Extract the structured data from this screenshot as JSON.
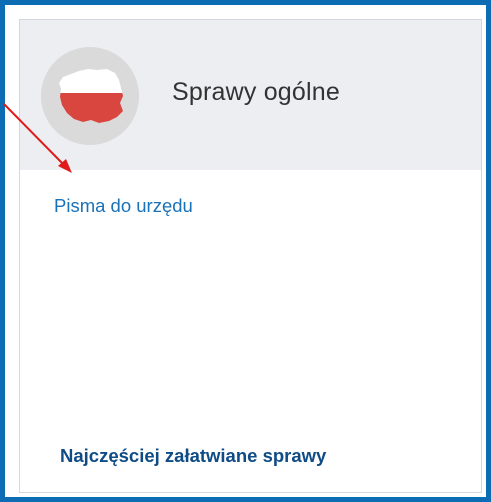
{
  "tile": {
    "title": "Sprawy ogólne",
    "icon": "poland-map-icon",
    "link_label": "Pisma do urzędu",
    "footer_label": "Najczęściej załatwiane sprawy"
  },
  "colors": {
    "frame_border": "#0c6db4",
    "header_background": "#eceef1",
    "link": "#1a72b8",
    "footer_link": "#0f4c86",
    "flag_red": "#d9463f",
    "annotation_arrow": "#e01b1b"
  }
}
